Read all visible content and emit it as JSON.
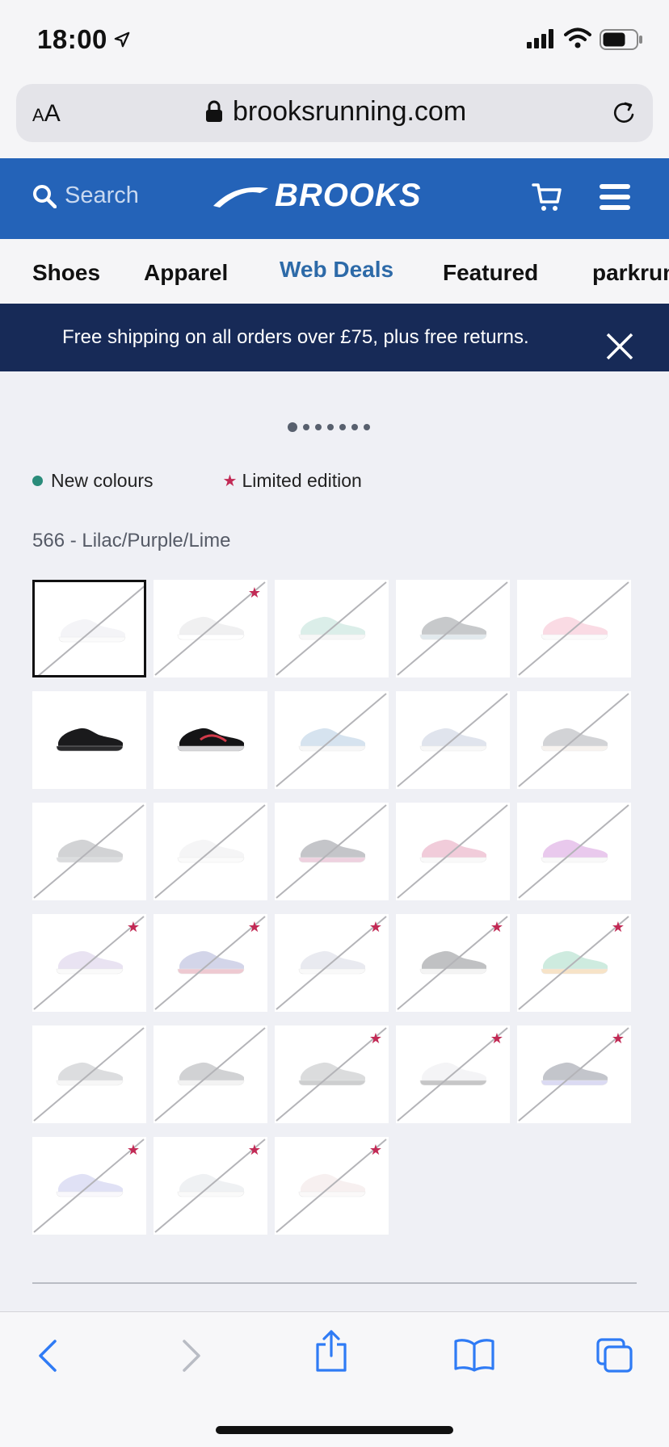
{
  "status_bar": {
    "time": "18:00"
  },
  "browser": {
    "text_size_small": "A",
    "text_size_large": "A",
    "url": "brooksrunning.com"
  },
  "header": {
    "search_label": "Search",
    "logo_text": "BROOKS"
  },
  "nav": {
    "tabs": [
      {
        "label": "Shoes"
      },
      {
        "label": "Apparel"
      },
      {
        "label": "Web Deals"
      },
      {
        "label": "Featured"
      },
      {
        "label": "parkrun"
      }
    ],
    "active_tab": "Web Deals"
  },
  "promo": {
    "text": "Free shipping on all orders over £75, plus free returns."
  },
  "carousel": {
    "total_slides": 7,
    "current_slide": 1
  },
  "legend": {
    "new_colours": "New colours",
    "limited_edition": "Limited edition"
  },
  "selected_colour": "566 - Lilac/Purple/Lime",
  "colors": {
    "brand_blue": "#2463b8",
    "promo_navy": "#172a57",
    "active_tab": "#2d6aa8",
    "limited_star": "#c22a55",
    "new_dot": "#2a8c7a"
  },
  "swatches": [
    {
      "upper": "#dcdde6",
      "sole": "#f2f2f4",
      "available": false,
      "limited": false,
      "selected": true
    },
    {
      "upper": "#d0d0d4",
      "sole": "#ffffff",
      "available": false,
      "limited": true,
      "selected": false
    },
    {
      "upper": "#8ccab8",
      "sole": "#e8e8e8",
      "available": false,
      "limited": false,
      "selected": false
    },
    {
      "upper": "#4a5057",
      "sole": "#9fb7c7",
      "available": false,
      "limited": false,
      "selected": false
    },
    {
      "upper": "#f08aa8",
      "sole": "#f5f5f5",
      "available": false,
      "limited": false,
      "selected": false
    },
    {
      "upper": "#1a1a1c",
      "sole": "#2a2a2c",
      "available": true,
      "limited": false,
      "selected": false
    },
    {
      "upper": "#141416",
      "sole": "#d7d7da",
      "accent": "#d23a4a",
      "available": true,
      "limited": false,
      "selected": false
    },
    {
      "upper": "#7aa6cc",
      "sole": "#e8e8e8",
      "available": false,
      "limited": false,
      "selected": false
    },
    {
      "upper": "#9aa8c6",
      "sole": "#eaeaea",
      "available": false,
      "limited": false,
      "selected": false
    },
    {
      "upper": "#6e7179",
      "sole": "#e6d9cc",
      "available": false,
      "limited": false,
      "selected": false
    },
    {
      "upper": "#6d7076",
      "sole": "#8a8d93",
      "available": false,
      "limited": false,
      "selected": false
    },
    {
      "upper": "#e0e0e3",
      "sole": "#f4f4f4",
      "available": false,
      "limited": false,
      "selected": false
    },
    {
      "upper": "#3e4350",
      "sole": "#c96a96",
      "available": false,
      "limited": false,
      "selected": false
    },
    {
      "upper": "#d45a88",
      "sole": "#eeeeee",
      "available": false,
      "limited": false,
      "selected": false
    },
    {
      "upper": "#b84fc4",
      "sole": "#ededed",
      "available": false,
      "limited": false,
      "selected": false
    },
    {
      "upper": "#b7a6d6",
      "sole": "#f0f0f0",
      "available": false,
      "limited": true,
      "selected": false
    },
    {
      "upper": "#7078b8",
      "sole": "#c8506a",
      "available": false,
      "limited": true,
      "selected": false
    },
    {
      "upper": "#b8bccf",
      "sole": "#eeeeee",
      "available": false,
      "limited": true,
      "selected": false
    },
    {
      "upper": "#33363b",
      "sole": "#dddddd",
      "available": false,
      "limited": true,
      "selected": false
    },
    {
      "upper": "#5fbf99",
      "sole": "#e7a44a",
      "available": false,
      "limited": true,
      "selected": false
    },
    {
      "upper": "#8d9096",
      "sole": "#e6e6e6",
      "available": false,
      "limited": false,
      "selected": false
    },
    {
      "upper": "#6a6d73",
      "sole": "#d9d9d9",
      "available": false,
      "limited": false,
      "selected": false
    },
    {
      "upper": "#8b8e92",
      "sole": "#5c5f63",
      "available": false,
      "limited": true,
      "selected": false
    },
    {
      "upper": "#dedee2",
      "sole": "#444448",
      "available": false,
      "limited": true,
      "selected": false
    },
    {
      "upper": "#3c4156",
      "sole": "#8a86d8",
      "available": false,
      "limited": true,
      "selected": false
    },
    {
      "upper": "#9c9ee0",
      "sole": "#ecebf7",
      "available": false,
      "limited": true,
      "selected": false
    },
    {
      "upper": "#cdd2da",
      "sole": "#f1f1f1",
      "available": false,
      "limited": true,
      "selected": false
    },
    {
      "upper": "#e8cfcf",
      "sole": "#f3eeee",
      "available": false,
      "limited": true,
      "selected": false
    }
  ]
}
